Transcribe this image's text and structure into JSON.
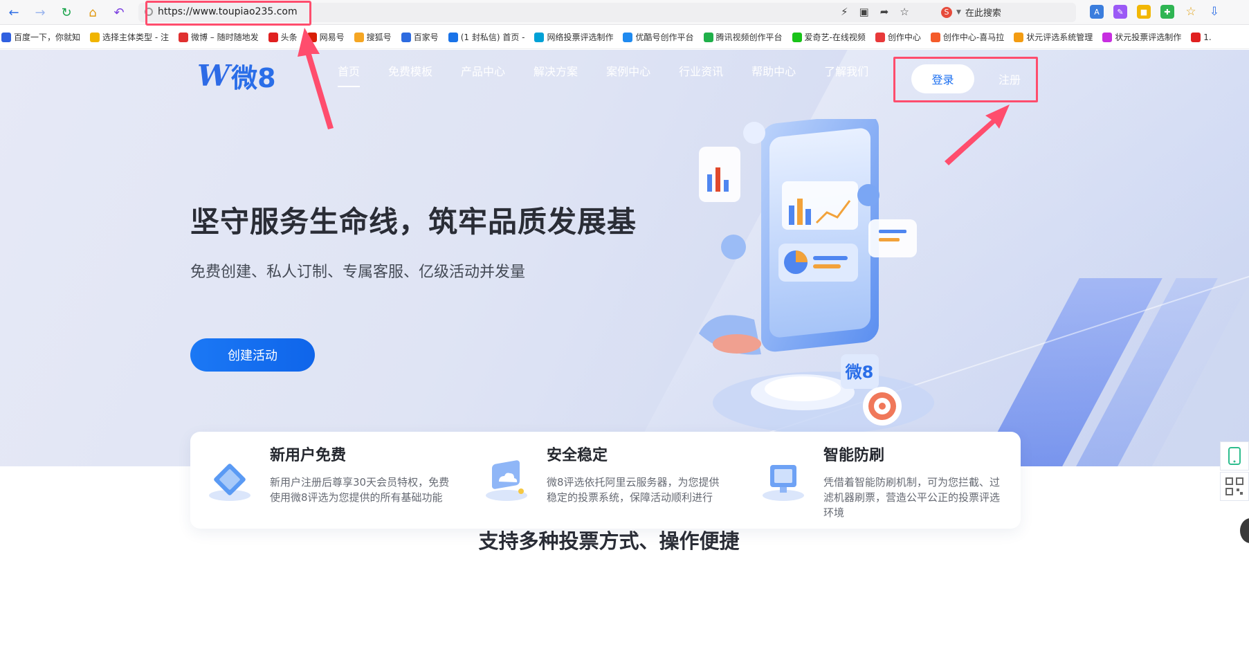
{
  "browser": {
    "url": "https://www.toupiao235.com",
    "search_placeholder": "在此搜索"
  },
  "bookmarks": [
    {
      "label": "百度一下，你就知",
      "color": "#3060e0"
    },
    {
      "label": "选择主体类型 - 注",
      "color": "#f0b400"
    },
    {
      "label": "微博 – 随时随地发",
      "color": "#e03030"
    },
    {
      "label": "头条",
      "color": "#e02020"
    },
    {
      "label": "网易号",
      "color": "#d81e06"
    },
    {
      "label": "搜狐号",
      "color": "#f5a623"
    },
    {
      "label": "百家号",
      "color": "#2d6be0"
    },
    {
      "label": "(1 封私信) 首页 -",
      "color": "#1a73e8"
    },
    {
      "label": "网络投票评选制作",
      "color": "#00a1d6"
    },
    {
      "label": "优酷号创作平台",
      "color": "#1f8af0"
    },
    {
      "label": "腾讯视频创作平台",
      "color": "#20b04a"
    },
    {
      "label": "爱奇艺-在线视频",
      "color": "#19c319"
    },
    {
      "label": "创作中心",
      "color": "#e8393a"
    },
    {
      "label": "创作中心-喜马拉",
      "color": "#f45b2a"
    },
    {
      "label": "状元评选系统管理",
      "color": "#f39c12"
    },
    {
      "label": "状元投票评选制作",
      "color": "#c72ee0"
    },
    {
      "label": "1.",
      "color": "#e02020"
    }
  ],
  "site": {
    "logo_letter": "W",
    "logo_text": "微8",
    "nav": [
      {
        "label": "首页",
        "active": true
      },
      {
        "label": "免费模板",
        "active": false
      },
      {
        "label": "产品中心",
        "active": false
      },
      {
        "label": "解决方案",
        "active": false
      },
      {
        "label": "案例中心",
        "active": false
      },
      {
        "label": "行业资讯",
        "active": false
      },
      {
        "label": "帮助中心",
        "active": false
      },
      {
        "label": "了解我们",
        "active": false
      }
    ],
    "login_label": "登录",
    "register_label": "注册"
  },
  "hero": {
    "title": "坚守服务生命线，筑牢品质发展基",
    "subtitle": "免费创建、私人订制、专属客服、亿级活动并发量",
    "cta_label": "创建活动",
    "illustration_badge": "微8"
  },
  "features": [
    {
      "title": "新用户免费",
      "desc": "新用户注册后尊享30天会员特权，免费使用微8评选为您提供的所有基础功能"
    },
    {
      "title": "安全稳定",
      "desc": "微8评选依托阿里云服务器，为您提供稳定的投票系统，保障活动顺利进行"
    },
    {
      "title": "智能防刷",
      "desc": "凭借着智能防刷机制，可为您拦截、过滤机器刷票，营造公平公正的投票评选环境"
    }
  ],
  "section": {
    "title": "支持多种投票方式、操作便捷"
  },
  "colors": {
    "accent": "#1b6ff0",
    "annotation": "#ff4d6d",
    "hero_bg": "#dfe4f4"
  }
}
